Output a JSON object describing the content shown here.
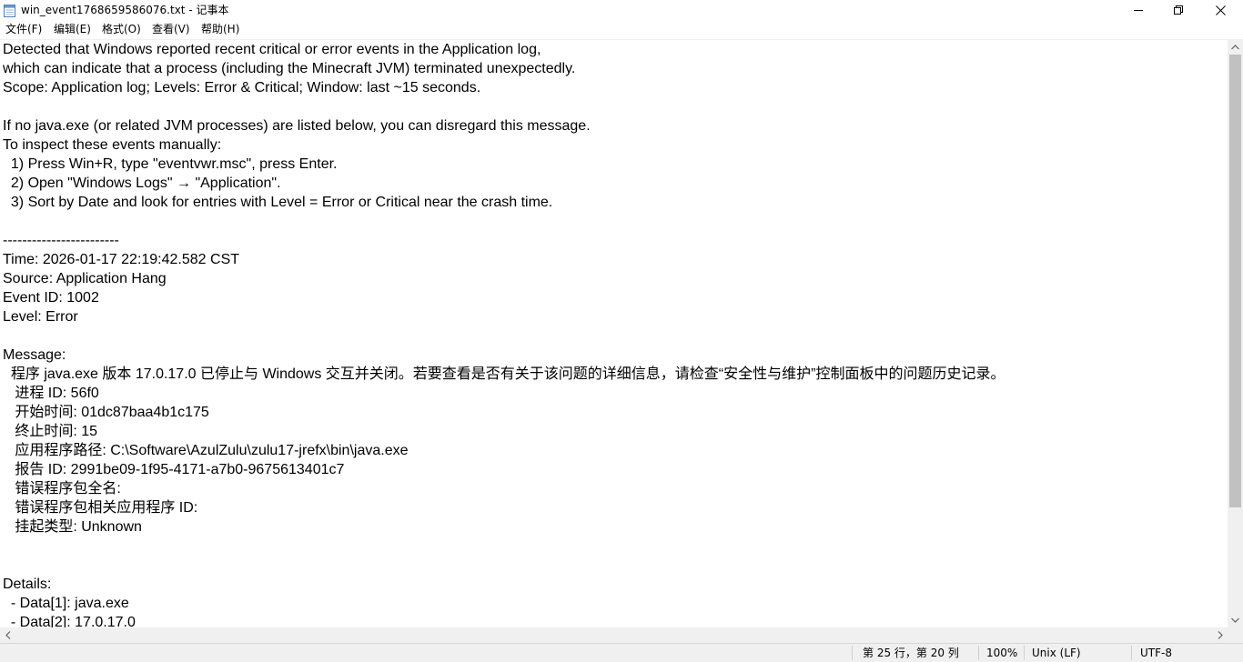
{
  "window": {
    "title": "win_event1768659586076.txt - 记事本"
  },
  "menu": {
    "file": "文件(F)",
    "edit": "编辑(E)",
    "format": "格式(O)",
    "view": "查看(V)",
    "help": "帮助(H)"
  },
  "document": {
    "lines": [
      "Detected that Windows reported recent critical or error events in the Application log,",
      "which can indicate that a process (including the Minecraft JVM) terminated unexpectedly.",
      "Scope: Application log; Levels: Error & Critical; Window: last ~15 seconds.",
      "",
      "If no java.exe (or related JVM processes) are listed below, you can disregard this message.",
      "To inspect these events manually:",
      "  1) Press Win+R, type \"eventvwr.msc\", press Enter.",
      "  2) Open \"Windows Logs\" → \"Application\".",
      "  3) Sort by Date and look for entries with Level = Error or Critical near the crash time.",
      "",
      "------------------------",
      "Time: 2026-01-17 22:19:42.582 CST",
      "Source: Application Hang",
      "Event ID: 1002",
      "Level: Error",
      "",
      "Message:",
      "  程序 java.exe 版本 17.0.17.0 已停止与 Windows 交互并关闭。若要查看是否有关于该问题的详细信息，请检查“安全性与维护”控制面板中的问题历史记录。",
      "   进程 ID: 56f0",
      "   开始时间: 01dc87baa4b1c175",
      "   终止时间: 15",
      "   应用程序路径: C:\\Software\\AzulZulu\\zulu17-jrefx\\bin\\java.exe",
      "   报告 ID: 2991be09-1f95-4171-a7b0-9675613401c7",
      "   错误程序包全名: ",
      "   错误程序包相关应用程序 ID: ",
      "   挂起类型: Unknown",
      "",
      "",
      "Details:",
      "  - Data[1]: java.exe",
      "  - Data[2]: 17.0.17.0"
    ]
  },
  "status": {
    "position": "第 25 行，第 20 列",
    "zoom": "100%",
    "line_ending": "Unix (LF)",
    "encoding": "UTF-8"
  }
}
